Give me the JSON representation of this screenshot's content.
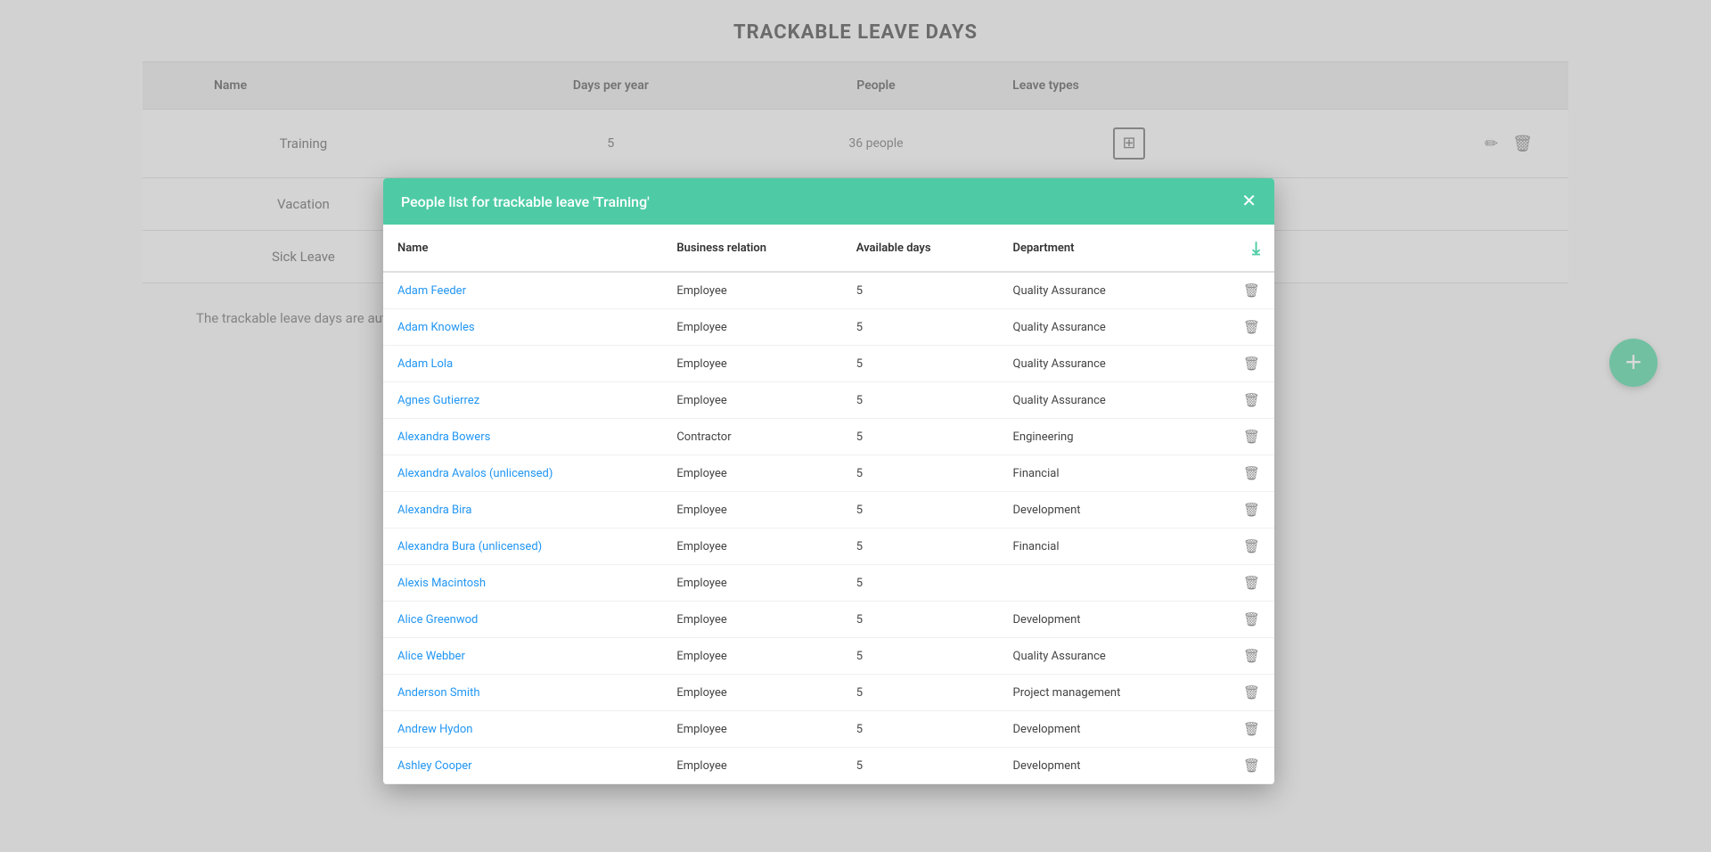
{
  "page": {
    "title": "TRACKABLE LEAVE DAYS"
  },
  "mainTable": {
    "columns": [
      "Name",
      "Days per year",
      "People",
      "Leave types"
    ],
    "rows": [
      {
        "name": "Training",
        "daysPerYear": "5",
        "people": "36 people",
        "hasLeaveTypes": true
      },
      {
        "name": "Vacation",
        "daysPerYear": "",
        "people": "",
        "hasLeaveTypes": false
      },
      {
        "name": "Sick Leave",
        "daysPerYear": "",
        "people": "",
        "hasLeaveTypes": false
      }
    ]
  },
  "resetText": "The trackable leave days are automatically reset o...",
  "modal": {
    "title": "People list for trackable leave 'Training'",
    "columns": {
      "name": "Name",
      "businessRelation": "Business relation",
      "availableDays": "Available days",
      "department": "Department"
    },
    "people": [
      {
        "name": "Adam Feeder",
        "businessRelation": "Employee",
        "availableDays": "5",
        "department": "Quality Assurance"
      },
      {
        "name": "Adam Knowles",
        "businessRelation": "Employee",
        "availableDays": "5",
        "department": "Quality Assurance"
      },
      {
        "name": "Adam Lola",
        "businessRelation": "Employee",
        "availableDays": "5",
        "department": "Quality Assurance"
      },
      {
        "name": "Agnes Gutierrez",
        "businessRelation": "Employee",
        "availableDays": "5",
        "department": "Quality Assurance"
      },
      {
        "name": "Alexandra Bowers",
        "businessRelation": "Contractor",
        "availableDays": "5",
        "department": "Engineering"
      },
      {
        "name": "Alexandra Avalos (unlicensed)",
        "businessRelation": "Employee",
        "availableDays": "5",
        "department": "Financial"
      },
      {
        "name": "Alexandra Bira",
        "businessRelation": "Employee",
        "availableDays": "5",
        "department": "Development"
      },
      {
        "name": "Alexandra Bura (unlicensed)",
        "businessRelation": "Employee",
        "availableDays": "5",
        "department": "Financial"
      },
      {
        "name": "Alexis Macintosh",
        "businessRelation": "Employee",
        "availableDays": "5",
        "department": ""
      },
      {
        "name": "Alice Greenwod",
        "businessRelation": "Employee",
        "availableDays": "5",
        "department": "Development"
      },
      {
        "name": "Alice Webber",
        "businessRelation": "Employee",
        "availableDays": "5",
        "department": "Quality Assurance"
      },
      {
        "name": "Anderson Smith",
        "businessRelation": "Employee",
        "availableDays": "5",
        "department": "Project management"
      },
      {
        "name": "Andrew Hydon",
        "businessRelation": "Employee",
        "availableDays": "5",
        "department": "Development"
      },
      {
        "name": "Ashley Cooper",
        "businessRelation": "Employee",
        "availableDays": "5",
        "department": "Development"
      }
    ]
  },
  "fab": {
    "label": "+"
  }
}
